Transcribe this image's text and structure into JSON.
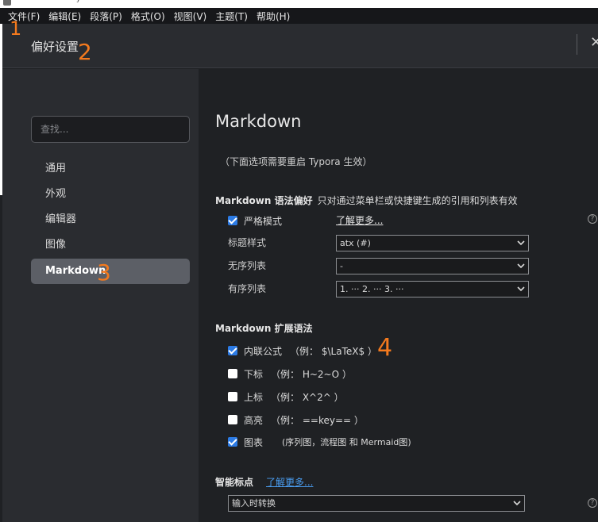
{
  "titlebar": {
    "fragment": "y"
  },
  "menubar": [
    "文件(F)",
    "编辑(E)",
    "段落(P)",
    "格式(O)",
    "视图(V)",
    "主题(T)",
    "帮助(H)"
  ],
  "dialog": {
    "title": "偏好设置",
    "close_glyph": "✕"
  },
  "sidebar": {
    "search_placeholder": "查找...",
    "items": [
      "通用",
      "外观",
      "编辑器",
      "图像",
      "Markdown"
    ],
    "active_index": 4
  },
  "main": {
    "title": "Markdown",
    "restart_note": "（下面选项需要重启 Typora 生效）",
    "syntax_pref": {
      "title": "Markdown 语法偏好",
      "subtitle": "只对通过菜单栏或快捷键生成的引用和列表有效",
      "strict_mode": {
        "label": "严格模式",
        "checked": true
      },
      "learn_more": "了解更多...",
      "heading_style": {
        "label": "标题样式",
        "value": "atx (#)"
      },
      "unordered_list": {
        "label": "无序列表",
        "value": "-"
      },
      "ordered_list": {
        "label": "有序列表",
        "value": "1. ··· 2. ··· 3. ···"
      }
    },
    "extensions": {
      "title": "Markdown 扩展语法",
      "items": [
        {
          "label": "内联公式",
          "hint": "（例： $\\LaTeX$ ）",
          "checked": true
        },
        {
          "label": "下标",
          "hint": "（例： H~2~O ）",
          "checked": false
        },
        {
          "label": "上标",
          "hint": "（例： X^2^ ）",
          "checked": false
        },
        {
          "label": "高亮",
          "hint": "（例： ==key== ）",
          "checked": false
        },
        {
          "label": "图表",
          "hint": "(序列图，流程图 和 Mermaid图)",
          "checked": true
        }
      ]
    },
    "smart_punct": {
      "title": "智能标点",
      "learn_more": "了解更多...",
      "value": "输入时转换"
    },
    "help_glyph": "?"
  },
  "annotations": [
    "1",
    "2",
    "3",
    "4"
  ],
  "colors": {
    "accent": "#2c7be5",
    "annotation": "#f47a1e",
    "link": "#4a9df0"
  }
}
